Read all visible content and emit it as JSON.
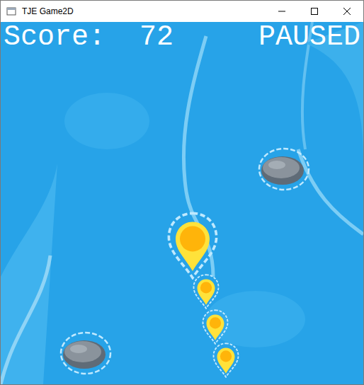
{
  "window": {
    "title": "TJE Game2D"
  },
  "hud": {
    "score": "Score:  72",
    "status": "PAUSED",
    "paused": true
  }
}
